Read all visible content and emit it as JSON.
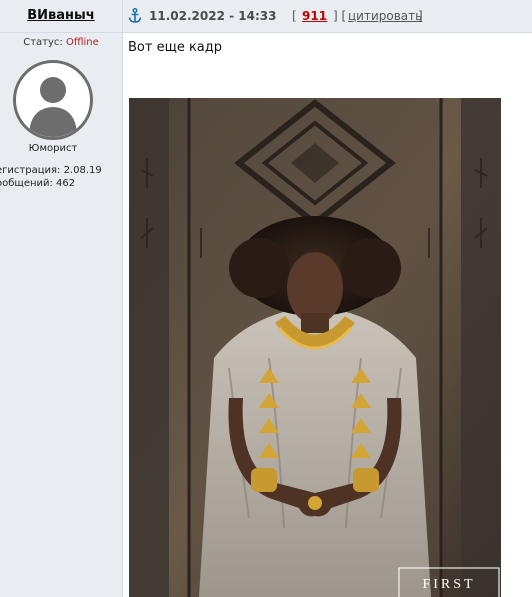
{
  "author": {
    "name": "ВИваныч",
    "status_label": "Статус:",
    "status_value": "Offline",
    "rank": "Юморист",
    "registration": "егистрация: 2.08.19",
    "messages": "ообщений: 462"
  },
  "post": {
    "date": "11.02.2022 - 14:33",
    "number": "911",
    "quote_label": "цитировать",
    "text": "Вот еще кадр",
    "image_watermark": "FIRST"
  },
  "colors": {
    "header_bg": "#e9edf2",
    "status_offline": "#b22222",
    "post_number": "#c00000"
  },
  "icons": {
    "post_anchor": "anchor-icon",
    "avatar": "default-user-silhouette"
  }
}
